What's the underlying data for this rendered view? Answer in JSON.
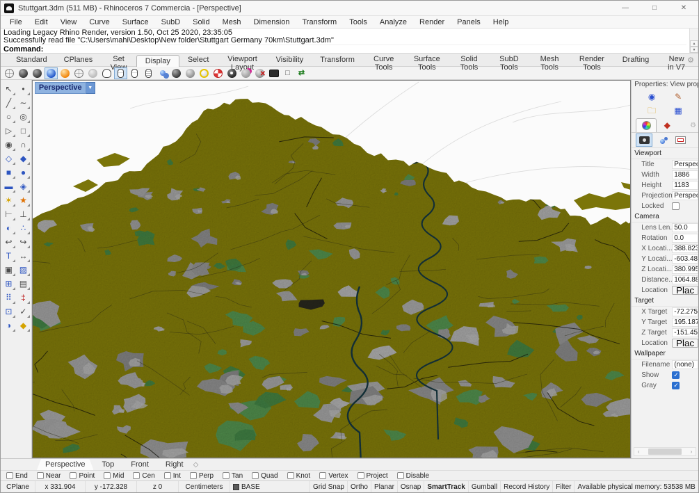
{
  "window": {
    "title": "Stuttgart.3dm (511 MB) - Rhinoceros 7 Commercia - [Perspective]",
    "controls": [
      {
        "name": "minimize-button",
        "glyph": "—"
      },
      {
        "name": "maximize-button",
        "glyph": "□"
      },
      {
        "name": "close-button",
        "glyph": "✕"
      }
    ]
  },
  "menu": {
    "items": [
      {
        "label": "File",
        "name": "menu-file"
      },
      {
        "label": "Edit",
        "name": "menu-edit"
      },
      {
        "label": "View",
        "name": "menu-view"
      },
      {
        "label": "Curve",
        "name": "menu-curve"
      },
      {
        "label": "Surface",
        "name": "menu-surface"
      },
      {
        "label": "SubD",
        "name": "menu-subd"
      },
      {
        "label": "Solid",
        "name": "menu-solid"
      },
      {
        "label": "Mesh",
        "name": "menu-mesh"
      },
      {
        "label": "Dimension",
        "name": "menu-dimension"
      },
      {
        "label": "Transform",
        "name": "menu-transform"
      },
      {
        "label": "Tools",
        "name": "menu-tools"
      },
      {
        "label": "Analyze",
        "name": "menu-analyze"
      },
      {
        "label": "Render",
        "name": "menu-render"
      },
      {
        "label": "Panels",
        "name": "menu-panels"
      },
      {
        "label": "Help",
        "name": "menu-help"
      }
    ]
  },
  "command": {
    "history": [
      {
        "text": "Loading Legacy Rhino Render, version 1.50, Oct 25 2020, 23:35:05",
        "name": "command-history-line"
      },
      {
        "text": "Successfully read file \"C:\\Users\\mahi\\Desktop\\New folder\\Stuttgart Germany 70km\\Stuttgart.3dm\"",
        "name": "command-history-line"
      }
    ],
    "prompt": "Command:",
    "spin_up": "▲",
    "spin_down": "▼"
  },
  "tabbar": {
    "gear": "⚙",
    "tabs": [
      {
        "label": "Standard",
        "name": "tab-standard"
      },
      {
        "label": "CPlanes",
        "name": "tab-cplanes"
      },
      {
        "label": "Set View",
        "name": "tab-set-view"
      },
      {
        "label": "Display",
        "name": "tab-display",
        "active": true
      },
      {
        "label": "Select",
        "name": "tab-select"
      },
      {
        "label": "Viewport Layout",
        "name": "tab-viewport-layout"
      },
      {
        "label": "Visibility",
        "name": "tab-visibility"
      },
      {
        "label": "Transform",
        "name": "tab-transform"
      },
      {
        "label": "Curve Tools",
        "name": "tab-curve-tools"
      },
      {
        "label": "Surface Tools",
        "name": "tab-surface-tools"
      },
      {
        "label": "Solid Tools",
        "name": "tab-solid-tools"
      },
      {
        "label": "SubD Tools",
        "name": "tab-subd-tools"
      },
      {
        "label": "Mesh Tools",
        "name": "tab-mesh-tools"
      },
      {
        "label": "Render Tools",
        "name": "tab-render-tools"
      },
      {
        "label": "Drafting",
        "name": "tab-drafting"
      },
      {
        "label": "New in V7",
        "name": "tab-new-in-v7"
      }
    ]
  },
  "top_toolbar": {
    "icons": [
      {
        "name": "wireframe-display-icon",
        "cls": "wire"
      },
      {
        "name": "shaded-display-icon",
        "cls": "dark"
      },
      {
        "name": "rendered-display-icon",
        "cls": "dark"
      },
      {
        "name": "blue-shaded-display-icon",
        "cls": "blue pressed"
      },
      {
        "name": "raytraced-display-icon",
        "cls": "orange"
      },
      {
        "name": "ghosted-display-icon",
        "cls": "wire"
      },
      {
        "name": "xray-display-icon",
        "cls": "ghost"
      },
      {
        "name": "render-preview-icon",
        "cls": "penguin"
      },
      {
        "name": "mouse-rotate-icon",
        "cls": "mouse pressed"
      },
      {
        "name": "mouse-pan-icon",
        "cls": "mouse"
      },
      {
        "name": "mouse-zoom-icon",
        "cls": "mouse lined"
      },
      {
        "name": "display-options-icon",
        "cls": "spheres"
      },
      {
        "name": "shade-object-icon",
        "cls": "dark"
      },
      {
        "name": "gray-sphere-icon",
        "cls": "gray"
      },
      {
        "name": "highlight-sphere-icon",
        "cls": "yellowring"
      },
      {
        "name": "cplane-target-icon",
        "cls": "target"
      },
      {
        "name": "eye-sphere-icon",
        "cls": "eye"
      },
      {
        "name": "pin-sphere-icon",
        "cls": "pin"
      },
      {
        "name": "clear-display-icon",
        "cls": "gray redx",
        "ovl": "✕"
      },
      {
        "name": "fullscreen-monitor-icon",
        "cls": "monitor"
      },
      {
        "name": "wire-box-icon",
        "cls": "none boxwire",
        "ovl": "□"
      },
      {
        "name": "refresh-shade-icon",
        "cls": "none cubearrow",
        "ovl": "⇄"
      }
    ]
  },
  "left_toolbar": {
    "icons": [
      {
        "name": "select-arrow-icon",
        "g": "↖"
      },
      {
        "name": "point-icon",
        "g": "•"
      },
      {
        "name": "polyline-icon",
        "g": "╱"
      },
      {
        "name": "freeform-curve-icon",
        "g": "∼"
      },
      {
        "name": "circle-icon",
        "g": "○"
      },
      {
        "name": "ellipse-icon",
        "g": "◎"
      },
      {
        "name": "polygon-icon",
        "g": "▷"
      },
      {
        "name": "rectangle-icon",
        "g": "□"
      },
      {
        "name": "circle-center-icon",
        "g": "◉"
      },
      {
        "name": "arc-icon",
        "g": "∩"
      },
      {
        "name": "surface-plane-icon",
        "g": "◇",
        "cls": "blue"
      },
      {
        "name": "surface-corner-icon",
        "g": "◆",
        "cls": "blue"
      },
      {
        "name": "box-icon",
        "g": "■",
        "cls": "blue"
      },
      {
        "name": "sphere-icon",
        "g": "●",
        "cls": "blue"
      },
      {
        "name": "cylinder-icon",
        "g": "▬",
        "cls": "blue"
      },
      {
        "name": "loft-surface-icon",
        "g": "◈",
        "cls": "blue"
      },
      {
        "name": "cage-edit-icon",
        "g": "✶",
        "cls": "gold"
      },
      {
        "name": "explode-icon",
        "g": "★",
        "cls": "orange"
      },
      {
        "name": "fillet-icon",
        "g": "⊢"
      },
      {
        "name": "chamfer-icon",
        "g": "⊥"
      },
      {
        "name": "boolean-icon",
        "g": "◐",
        "cls": "blue"
      },
      {
        "name": "points-icon",
        "g": "∴",
        "cls": "blue"
      },
      {
        "name": "adjust-curve-icon",
        "g": "↩"
      },
      {
        "name": "rebuild-curve-icon",
        "g": "↪"
      },
      {
        "name": "text-icon",
        "g": "T",
        "cls": "blue"
      },
      {
        "name": "dimension-icon",
        "g": "↔"
      },
      {
        "name": "block-icon",
        "g": "▣"
      },
      {
        "name": "trim-plane-icon",
        "g": "▨",
        "cls": "blue"
      },
      {
        "name": "extrude-icon",
        "g": "⊞",
        "cls": "blue"
      },
      {
        "name": "hatch-icon",
        "g": "▤"
      },
      {
        "name": "array-icon",
        "g": "⠿",
        "cls": "blue"
      },
      {
        "name": "dimension-chain-icon",
        "g": "‡",
        "cls": "red"
      },
      {
        "name": "copy-icon",
        "g": "⊡",
        "cls": "blue"
      },
      {
        "name": "check-icon",
        "g": "✓"
      },
      {
        "name": "shade-icon",
        "g": "◑",
        "cls": "blue"
      },
      {
        "name": "gem-icon",
        "g": "◆",
        "cls": "gold"
      }
    ]
  },
  "viewport": {
    "label": "Perspective",
    "dropdown_arrow": "▼",
    "colors": {
      "sky": "#fbfbfb",
      "skyline": "#cccccc",
      "land": "#7b7509",
      "forest": "#4c8a4e",
      "forest_dark": "#3d7a40",
      "urban": "#8f8f8f",
      "urban_light": "#ababab",
      "road": "rgba(45,45,22,0.55)",
      "road_dark": "rgba(18,18,10,0.75)",
      "river": "#14333c"
    }
  },
  "right_panel": {
    "header": "Properties: View prop...",
    "icons": {
      "properties": "◉",
      "pen": "✎",
      "material": "◆",
      "image": "▦",
      "gear": "⚙",
      "folder": "🗀"
    },
    "viewport_section": {
      "title": "Viewport",
      "rows": {
        "title": {
          "label": "Title",
          "value": "Perspect"
        },
        "width": {
          "label": "Width",
          "value": "1886"
        },
        "height": {
          "label": "Height",
          "value": "1183"
        },
        "projection": {
          "label": "Projection",
          "value": "Perspect"
        },
        "locked": {
          "label": "Locked",
          "checked": false
        }
      }
    },
    "camera_section": {
      "title": "Camera",
      "rows": {
        "lens": {
          "label": "Lens Len...",
          "value": "50.0"
        },
        "rotation": {
          "label": "Rotation",
          "value": "0.0"
        },
        "x": {
          "label": "X Locati...",
          "value": "388.823"
        },
        "y": {
          "label": "Y Locati...",
          "value": "-603.48"
        },
        "z": {
          "label": "Z Locati...",
          "value": "380.995"
        },
        "distance": {
          "label": "Distance...",
          "value": "1064.88"
        },
        "location": {
          "label": "Location",
          "button": "Plac"
        }
      }
    },
    "target_section": {
      "title": "Target",
      "rows": {
        "x": {
          "label": "X Target",
          "value": "-72.275"
        },
        "y": {
          "label": "Y Target",
          "value": "195.187"
        },
        "z": {
          "label": "Z Target",
          "value": "-151.45"
        },
        "location": {
          "label": "Location",
          "button": "Plac"
        }
      }
    },
    "wallpaper_section": {
      "title": "Wallpaper",
      "rows": {
        "filename": {
          "label": "Filename",
          "value": "(none)"
        },
        "show": {
          "label": "Show",
          "checked": true
        },
        "gray": {
          "label": "Gray",
          "checked": true
        }
      }
    },
    "hscroll": {
      "left": "‹",
      "right": "›"
    }
  },
  "viewport_tabs": {
    "tabs": [
      {
        "label": "Perspective",
        "name": "vptab-perspective",
        "active": true
      },
      {
        "label": "Top",
        "name": "vptab-top"
      },
      {
        "label": "Front",
        "name": "vptab-front"
      },
      {
        "label": "Right",
        "name": "vptab-right"
      }
    ],
    "new_viewport_glyph": "◇"
  },
  "osnap": {
    "items": [
      {
        "label": "End",
        "name": "osnap-end"
      },
      {
        "label": "Near",
        "name": "osnap-near"
      },
      {
        "label": "Point",
        "name": "osnap-point"
      },
      {
        "label": "Mid",
        "name": "osnap-mid"
      },
      {
        "label": "Cen",
        "name": "osnap-cen"
      },
      {
        "label": "Int",
        "name": "osnap-int"
      },
      {
        "label": "Perp",
        "name": "osnap-perp"
      },
      {
        "label": "Tan",
        "name": "osnap-tan"
      },
      {
        "label": "Quad",
        "name": "osnap-quad"
      },
      {
        "label": "Knot",
        "name": "osnap-knot"
      },
      {
        "label": "Vertex",
        "name": "osnap-vertex"
      },
      {
        "label": "Project",
        "name": "osnap-project"
      },
      {
        "label": "Disable",
        "name": "osnap-disable"
      }
    ]
  },
  "statusbar": {
    "cplane": "CPlane",
    "x": "x 331.904",
    "y": "y -172.328",
    "z": "z 0",
    "units": "Centimeters",
    "layer": "BASE",
    "grid_snap": "Grid Snap",
    "ortho": "Ortho",
    "planar": "Planar",
    "osnap": "Osnap",
    "smarttrack": "SmartTrack",
    "gumball": "Gumball",
    "record_history": "Record History",
    "filter": "Filter",
    "memory": "Available physical memory: 53538 MB"
  }
}
